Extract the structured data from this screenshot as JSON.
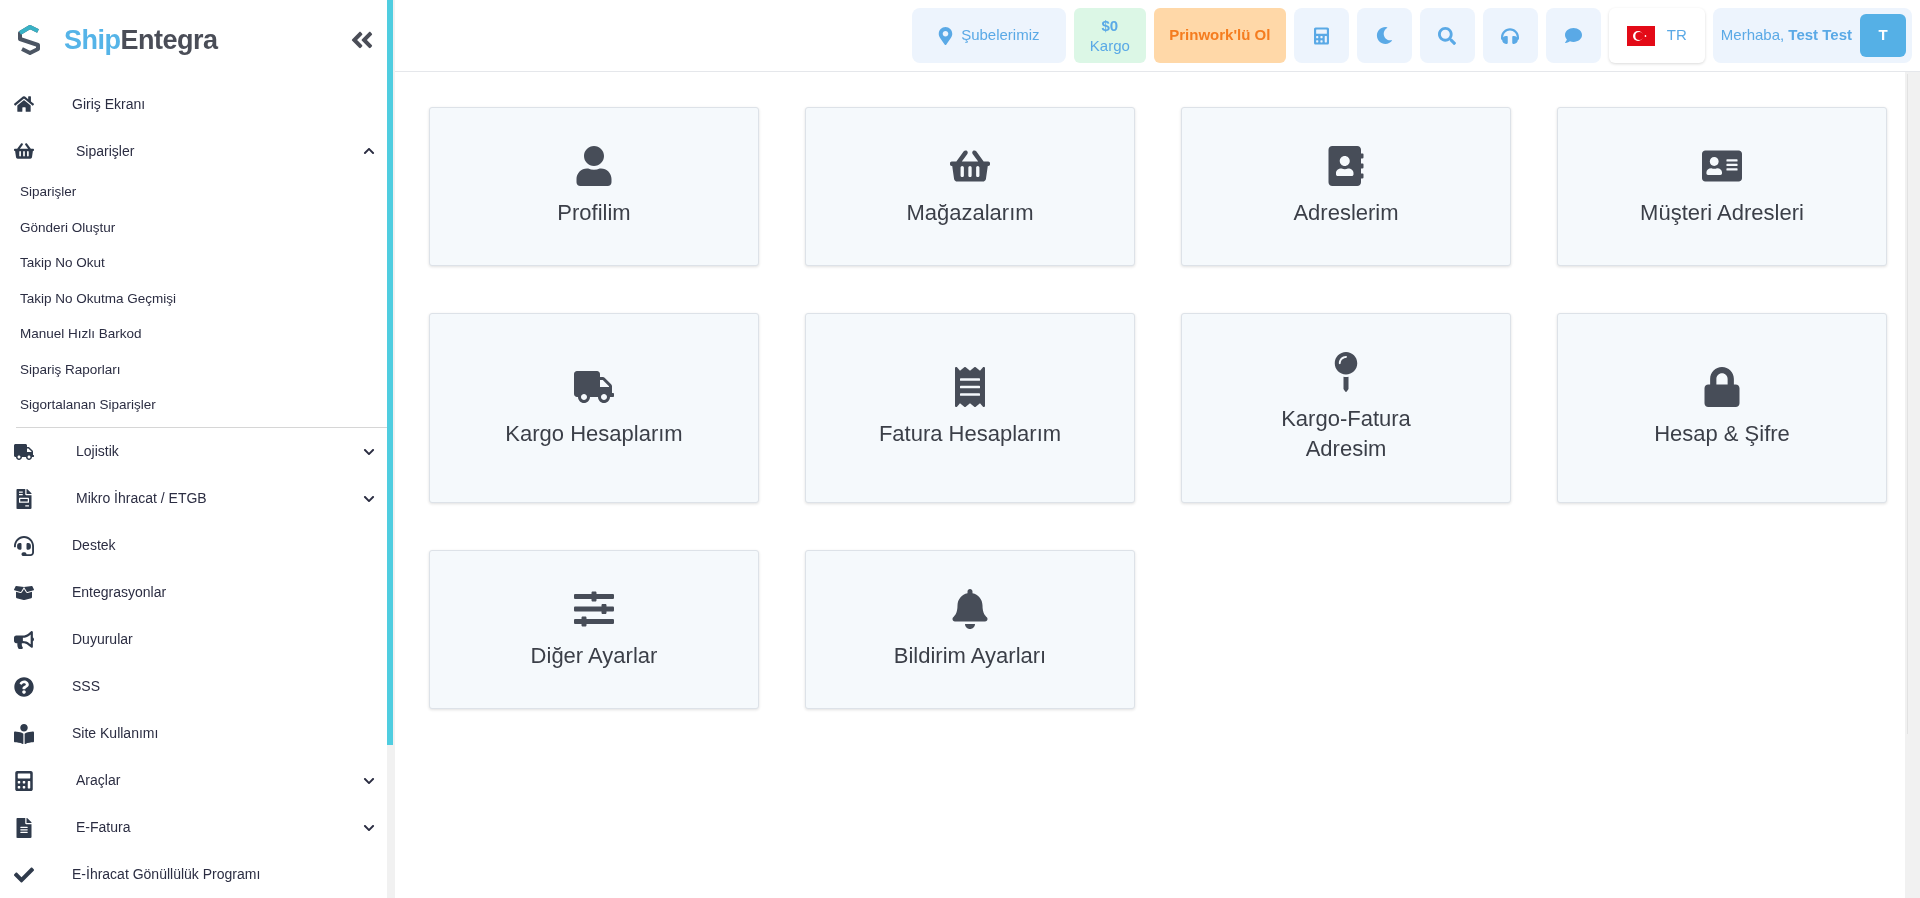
{
  "sidebar": {
    "logo": {
      "first": "Ship",
      "second": "Entegra"
    },
    "items": [
      {
        "kind": "link",
        "label": "Giriş Ekranı"
      },
      {
        "kind": "group",
        "label": "Siparişler",
        "expanded": true,
        "children": [
          {
            "label": "Siparişler"
          },
          {
            "label": "Gönderi Oluştur"
          },
          {
            "label": "Takip No Okut"
          },
          {
            "label": "Takip No Okutma Geçmişi"
          },
          {
            "label": "Manuel Hızlı Barkod"
          },
          {
            "label": "Sipariş Raporları"
          },
          {
            "label": "Sigortalanan Siparişler"
          }
        ]
      },
      {
        "kind": "group",
        "label": "Lojistik",
        "expanded": false
      },
      {
        "kind": "group",
        "label": "Mikro İhracat / ETGB",
        "expanded": false
      },
      {
        "kind": "link",
        "label": "Destek"
      },
      {
        "kind": "link",
        "label": "Entegrasyonlar"
      },
      {
        "kind": "link",
        "label": "Duyurular"
      },
      {
        "kind": "link",
        "label": "SSS"
      },
      {
        "kind": "link",
        "label": "Site Kullanımı"
      },
      {
        "kind": "group",
        "label": "Araçlar",
        "expanded": false
      },
      {
        "kind": "group",
        "label": "E-Fatura",
        "expanded": false
      },
      {
        "kind": "link",
        "label": "E-İhracat Gönüllülük Programı"
      }
    ]
  },
  "header": {
    "branches": "Şubelerimiz",
    "balance": {
      "amount": "$0",
      "label": "Kargo"
    },
    "promo": "Prinwork'lü Ol",
    "language": "TR",
    "greeting": "Merhaba,",
    "user_name": "Test Test",
    "avatar": "T"
  },
  "cards": [
    {
      "label": "Profilim"
    },
    {
      "label": "Mağazalarım"
    },
    {
      "label": "Adreslerim"
    },
    {
      "label": "Müşteri Adresleri"
    },
    {
      "label": "Kargo Hesaplarım"
    },
    {
      "label": "Fatura Hesaplarım"
    },
    {
      "label": "Kargo-Fatura Adresim"
    },
    {
      "label": "Hesap & Şifre"
    },
    {
      "label": "Diğer Ayarlar"
    },
    {
      "label": "Bildirim Ayarları"
    }
  ]
}
